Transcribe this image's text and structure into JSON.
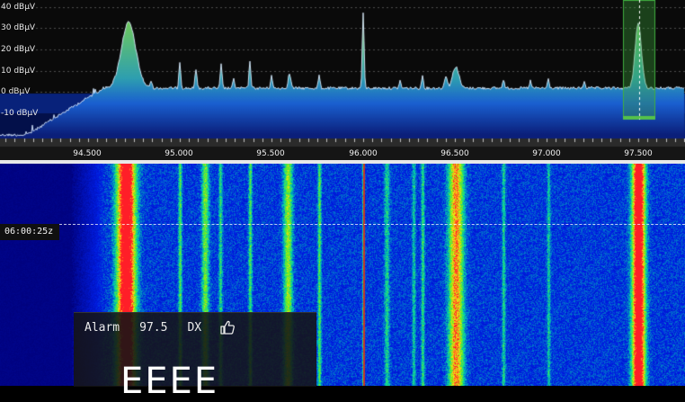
{
  "spectrum": {
    "y_axis_labels": [
      "40 dBµV",
      "30 dBµV",
      "20 dBµV",
      "10 dBµV",
      "0 dBµV",
      "-10 dBµV"
    ],
    "freq_axis_labels": [
      "94.500",
      "95.000",
      "95.500",
      "96.000",
      "96.500",
      "97.000",
      "97.500"
    ],
    "colors": {
      "bands_top": "#1b6fdc",
      "bands_bottom": "#0b1f7a",
      "peak": "#59c24a",
      "selection": "#3fae3f"
    }
  },
  "waterfall": {
    "time_label": "06:00:25z"
  },
  "rds_overlay": {
    "alarm_label": "Alarm",
    "frequency": "97.5",
    "mode_label": "DX",
    "big_text": "EEEE"
  },
  "icons": {
    "like": "thumbs-up-icon"
  }
}
